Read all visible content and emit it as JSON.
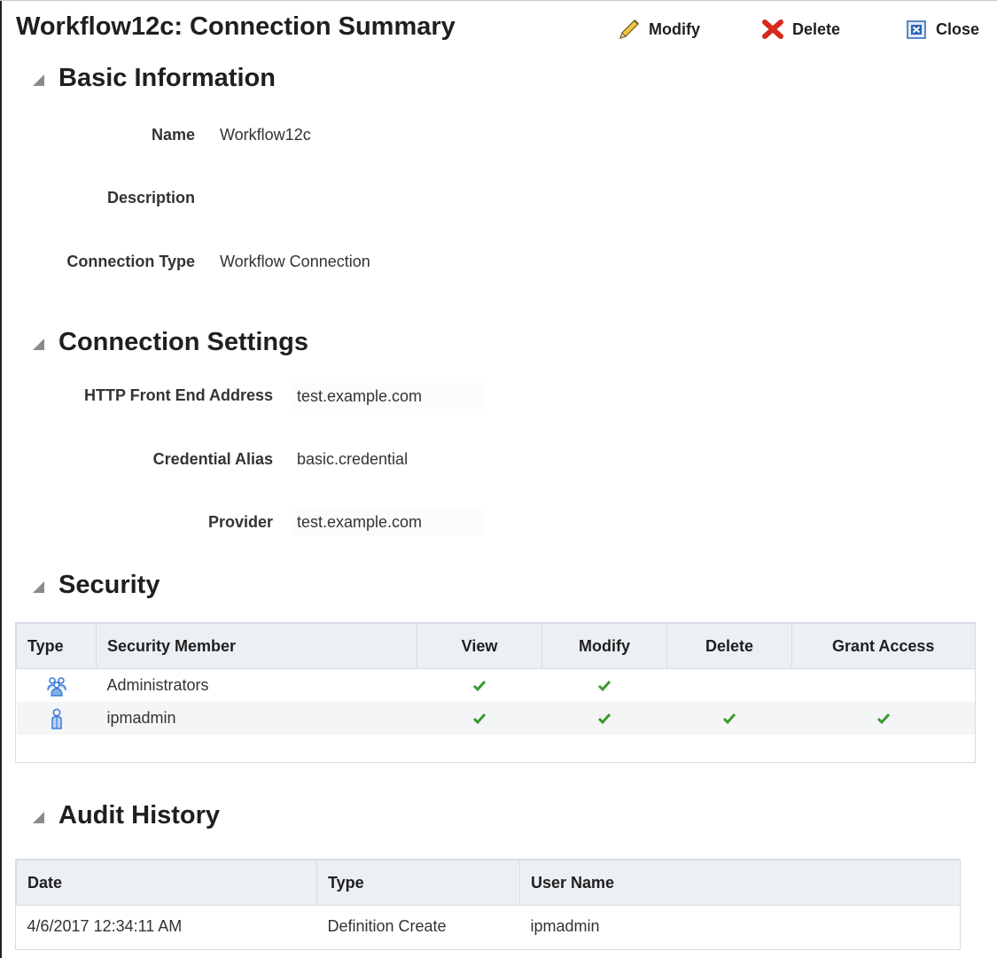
{
  "header": {
    "title": "Workflow12c: Connection Summary",
    "modify_label": "Modify",
    "delete_label": "Delete",
    "close_label": "Close"
  },
  "basic_info": {
    "title": "Basic Information",
    "name_label": "Name",
    "name_value": "Workflow12c",
    "description_label": "Description",
    "description_value": "",
    "connection_type_label": "Connection Type",
    "connection_type_value": "Workflow Connection"
  },
  "connection_settings": {
    "title": "Connection Settings",
    "http_label": "HTTP Front End Address",
    "http_value": "test.example.com",
    "credential_label": "Credential Alias",
    "credential_value": "basic.credential",
    "provider_label": "Provider",
    "provider_value": "test.example.com"
  },
  "security": {
    "title": "Security",
    "columns": [
      "Type",
      "Security Member",
      "View",
      "Modify",
      "Delete",
      "Grant Access"
    ],
    "rows": [
      {
        "type_icon": "group-icon",
        "member": "Administrators",
        "view": true,
        "modify": true,
        "delete": false,
        "grant": false
      },
      {
        "type_icon": "user-icon",
        "member": "ipmadmin",
        "view": true,
        "modify": true,
        "delete": true,
        "grant": true
      }
    ]
  },
  "audit": {
    "title": "Audit History",
    "columns": [
      "Date",
      "Type",
      "User Name"
    ],
    "rows": [
      {
        "date": "4/6/2017 12:34:11 AM",
        "type": "Definition Create",
        "user": "ipmadmin"
      }
    ]
  },
  "colors": {
    "check": "#3a9a2e",
    "delete_x": "#d62a1e",
    "close_icon": "#2a64b4",
    "icon_blue": "#3b7dd8"
  }
}
